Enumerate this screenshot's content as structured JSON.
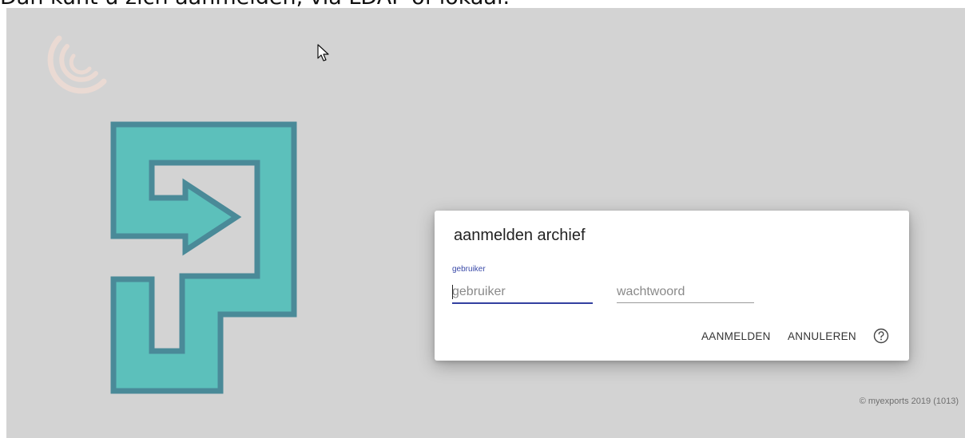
{
  "caption": "Dan kunt u zich aanmelden, via LDAP of lokaal.",
  "dialog": {
    "title": "aanmelden archief",
    "username_label": "gebruiker",
    "username_placeholder": "gebruiker",
    "password_placeholder": "wachtwoord",
    "login_button": "AANMELDEN",
    "cancel_button": "ANNULEREN"
  },
  "footer": {
    "copyright": "© myexports 2019 (1013)"
  },
  "icons": [
    "brand-swirl-icon",
    "login-logo-icon",
    "mouse-pointer-icon",
    "help-circle-icon"
  ],
  "colors": {
    "background": "#d3d3d3",
    "logo_fill": "#5cc0bb",
    "logo_stroke": "#4a8a98",
    "input_focus": "#3340a0"
  }
}
